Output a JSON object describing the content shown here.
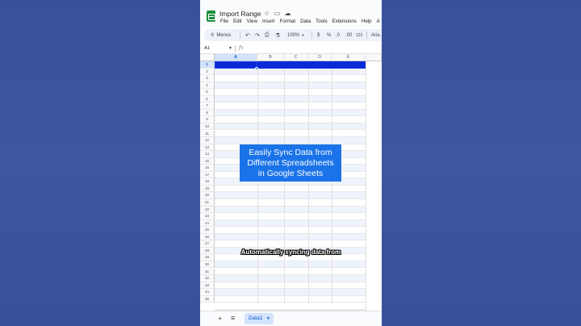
{
  "app": {
    "title": "Import Range",
    "menus": [
      "File",
      "Edit",
      "View",
      "Insert",
      "Format",
      "Data",
      "Tools",
      "Extensions",
      "Help",
      "A"
    ]
  },
  "toolbar": {
    "search_label": "Menus",
    "zoom": "100%",
    "currency": "$",
    "percent": "%",
    "decrease_decimal": ".0",
    "increase_decimal": ".00",
    "format_more": "123",
    "font": "Aria"
  },
  "formula_bar": {
    "cell_ref": "A1",
    "fx_label": "fx"
  },
  "grid": {
    "columns": [
      "A",
      "B",
      "C",
      "D",
      "E"
    ],
    "rows": [
      "1",
      "2",
      "3",
      "4",
      "5",
      "6",
      "7",
      "8",
      "9",
      "10",
      "11",
      "12",
      "13",
      "14",
      "15",
      "16",
      "17",
      "18",
      "19",
      "20",
      "21",
      "22",
      "23",
      "24",
      "25",
      "26",
      "27",
      "28",
      "29",
      "30",
      "31",
      "32",
      "33",
      "34",
      "35"
    ],
    "selected_cell": "A1"
  },
  "sheet_bar": {
    "add_label": "+",
    "list_label": "≡",
    "tab_name": "Data1"
  },
  "overlay": {
    "lines": [
      "Easily Sync Data from",
      "Different Spreadsheets",
      "in Google Sheets"
    ]
  },
  "caption": "Automatically syncing data from",
  "colors": {
    "background": "#3b539c",
    "accent": "#1a73e8",
    "selection": "#0a2bd8",
    "sheets_green": "#1e8e3e"
  }
}
